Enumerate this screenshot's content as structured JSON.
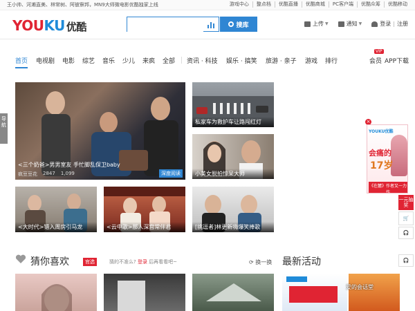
{
  "topbar": {
    "news": "王小帅、河濑直美、林常树、阿彼察邦，MN9大师微电影优酷独家上线",
    "links": [
      "游戏中心",
      "整点档",
      "优酷直播",
      "优酷商城",
      "PC客户端",
      "优酷众筹",
      "优酷移动"
    ]
  },
  "header": {
    "logo_you": "YOU",
    "logo_ku": "KU",
    "logo_cn": "优酷",
    "search_placeholder": "",
    "search_button": "搜库",
    "upload": "上传",
    "notify": "通知",
    "login": "登录",
    "register": "注册",
    "login_sep": "|"
  },
  "nav": {
    "items": [
      "首页",
      "电视剧",
      "电影",
      "综艺",
      "音乐",
      "少儿",
      "来疯",
      "全部",
      "资讯 · 科技",
      "娱乐 · 搞笑",
      "旅游 · 亲子",
      "游戏",
      "排行",
      "会员",
      "APP下载"
    ],
    "vip_badge": "VIP"
  },
  "sidetab": "导航",
  "thumbs": {
    "big": {
      "caption": "<三个奶爸>男男室友 手忙脚乱保卫baby",
      "source": "疯豆豆花",
      "plays": "2847",
      "comments": "1,099",
      "badge": "深度阅读"
    },
    "t1": "私家车为救护车让路闯红灯",
    "t2": "小美女脱拍惊呆大师",
    "t3": "<大时代>错入周房引马龙",
    "t4": "<云中歌>那人深宫常伴君",
    "t5": "[挑逗者]林更新嗨爆笑捧歌"
  },
  "ad": {
    "brand": "YOUKU优酷",
    "title": "会痛的",
    "age": "17岁",
    "foot": "《在麓》作者又一力作"
  },
  "rail": {
    "r1": "一元抽奖",
    "r2": "🛒",
    "r3": "🎧",
    "r4": "🎧"
  },
  "sections": {
    "guess": "猜你喜欢",
    "hot": "官选",
    "hint_pre": "猜的不准么?",
    "hint_link": "登录",
    "hint_post": "后再看看吧~",
    "refresh": "换一换",
    "activity": "最新活动"
  },
  "watermark": "爱的会话堂"
}
